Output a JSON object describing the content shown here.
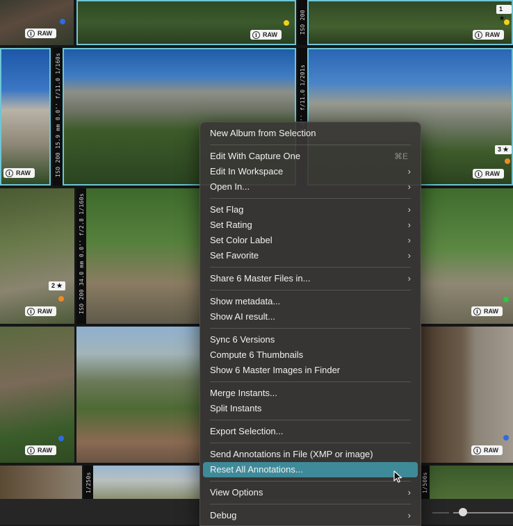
{
  "raw_badge": "RAW",
  "info_glyph": "i",
  "ratings": {
    "r1": "1 ★",
    "r2": "3 ★",
    "r3": "2 ★"
  },
  "exif": {
    "e1": "ISO 200",
    "e2": "ISO 200 15.9 mm 0.0'' f/11.0 1/160s",
    "e3": "0.0'' f/11.0 1/201s",
    "e4": "ISO 200 34.0 mm 0.0'' f/2.8 1/160s",
    "e5": "1/250s",
    "e6": "1/500s"
  },
  "label_colors": {
    "blue": "#2f6be0",
    "yellow": "#f1d21b",
    "orange": "#f08a24",
    "green": "#27c93f",
    "selection": "#6ec6d6"
  },
  "menu": {
    "new_album": "New Album from Selection",
    "edit_capture_one": "Edit With Capture One",
    "edit_capture_one_shortcut": "⌘E",
    "edit_workspace": "Edit In Workspace",
    "open_in": "Open In...",
    "set_flag": "Set Flag",
    "set_rating": "Set Rating",
    "set_color_label": "Set Color Label",
    "set_favorite": "Set Favorite",
    "share_master": "Share 6 Master Files in...",
    "show_metadata": "Show metadata...",
    "show_ai": "Show AI result...",
    "sync_versions": "Sync 6 Versions",
    "compute_thumbs": "Compute 6 Thumbnails",
    "show_master_finder": "Show 6 Master Images in Finder",
    "merge_instants": "Merge Instants...",
    "split_instants": "Split Instants",
    "export_selection": "Export Selection...",
    "send_annotations": "Send Annotations in File (XMP or image)",
    "reset_annotations": "Reset All Annotations...",
    "view_options": "View Options",
    "debug": "Debug",
    "chevron": "›"
  }
}
